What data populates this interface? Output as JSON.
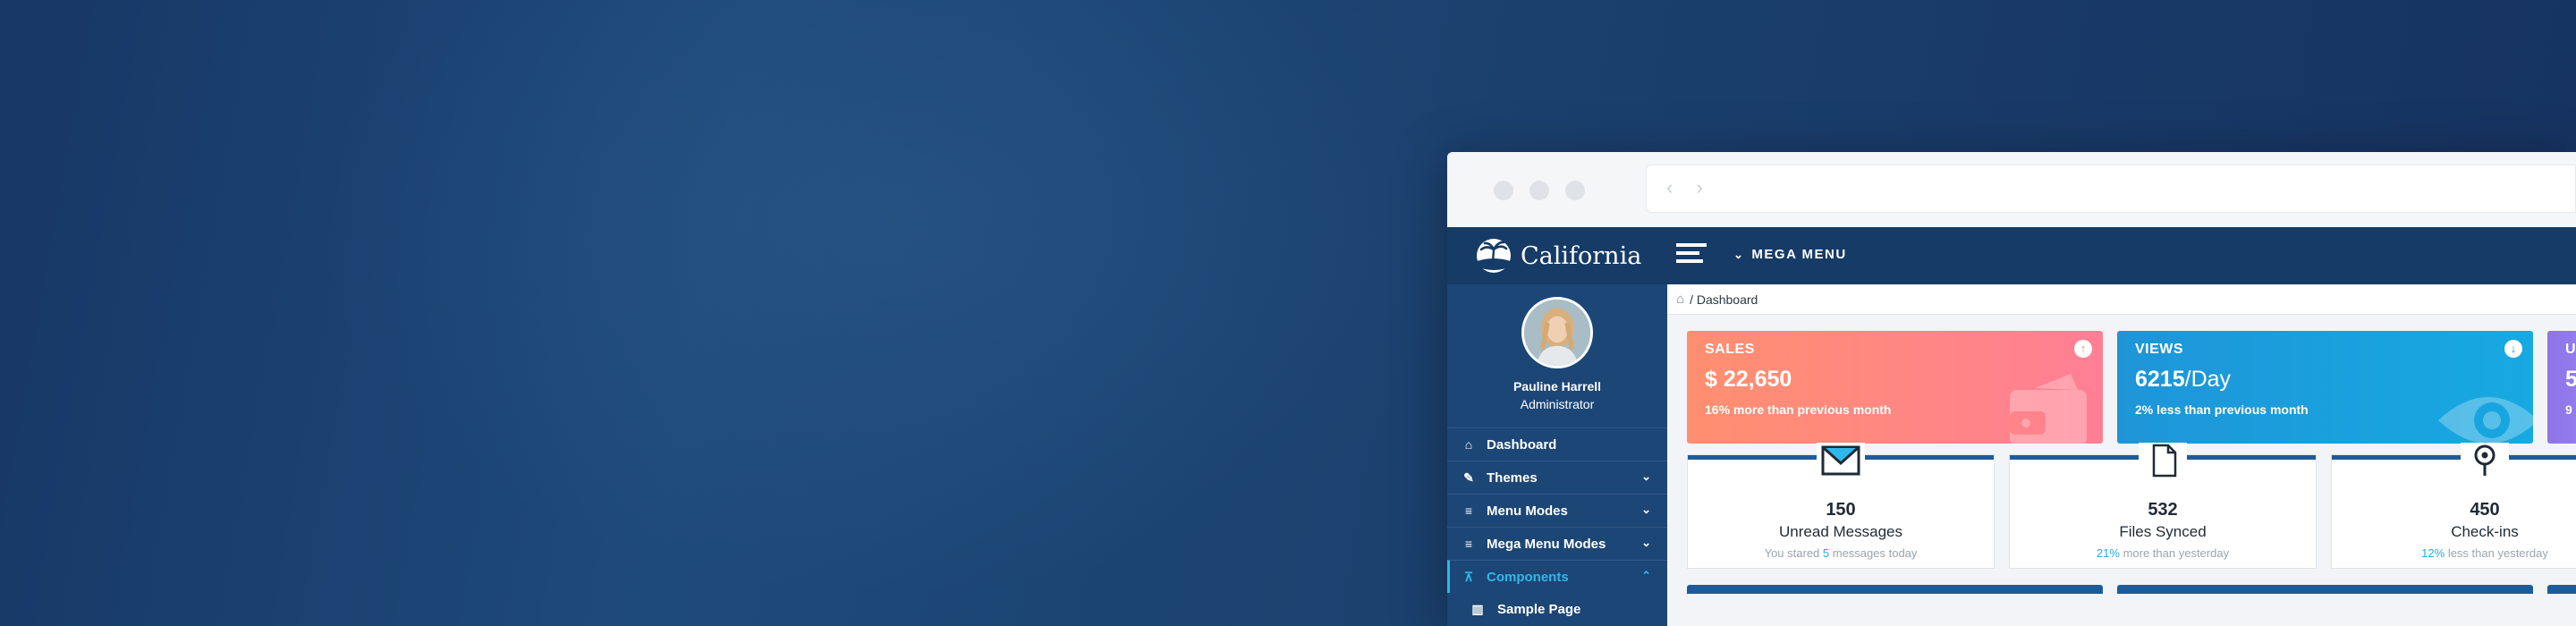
{
  "browser": {
    "nav_glyphs": "‹ ›"
  },
  "brand": {
    "name": "California",
    "logo": "palm-island-icon"
  },
  "topbar": {
    "menu_toggle": "hamburger-icon",
    "mega_label": "MEGA MENU",
    "mega_chevron": "⌄"
  },
  "profile": {
    "name": "Pauline Harrell",
    "role": "Administrator"
  },
  "sidebar": {
    "items": [
      {
        "label": "Dashboard",
        "icon": "home-icon",
        "glyph": "⌂",
        "caret": ""
      },
      {
        "label": "Themes",
        "icon": "brush-icon",
        "glyph": "✎",
        "caret": "⌄"
      },
      {
        "label": "Menu Modes",
        "icon": "menu-icon",
        "glyph": "≡",
        "caret": "⌄"
      },
      {
        "label": "Mega Menu Modes",
        "icon": "menu-icon",
        "glyph": "≡",
        "caret": "⌄"
      },
      {
        "label": "Components",
        "icon": "sitemap-icon",
        "glyph": "⊼",
        "caret": "⌃"
      },
      {
        "label": "Sample Page",
        "icon": "columns-icon",
        "glyph": "▥",
        "caret": ""
      }
    ],
    "active_index": 4
  },
  "breadcrumb": {
    "home_glyph": "⌂",
    "text": "/ Dashboard"
  },
  "cards": {
    "sales": {
      "title": "SALES",
      "value": "$ 22,650",
      "subtitle": "16% more than previous month",
      "badge": "↑",
      "color_from": "#ff8f6f",
      "color_to": "#ff7f95"
    },
    "views": {
      "title": "VIEWS",
      "value_strong": "6215",
      "value_rest": "/Day",
      "subtitle": "2% less than previous month",
      "badge": "↓",
      "color_from": "#1e95d8",
      "color_to": "#17a9e2"
    },
    "users": {
      "title": "U",
      "value": "5",
      "subtitle": "9"
    }
  },
  "stats": [
    {
      "icon": "envelope-icon",
      "number": "150",
      "label": "Unread Messages",
      "note_pre": "You stared ",
      "note_hl": "5",
      "note_post": " messages today"
    },
    {
      "icon": "file-icon",
      "number": "532",
      "label": "Files Synced",
      "note_pre": "",
      "note_hl": "21%",
      "note_post": " more than yesterday"
    },
    {
      "icon": "map-pin-icon",
      "number": "450",
      "label": "Check-ins",
      "note_pre": "",
      "note_hl": "12%",
      "note_post": " less than yesterday"
    }
  ],
  "theme": {
    "accent": "#2fb8ea",
    "sidebar": "#1c4676",
    "topbar": "#163b66",
    "stat_bar": "#1e5b9a"
  }
}
